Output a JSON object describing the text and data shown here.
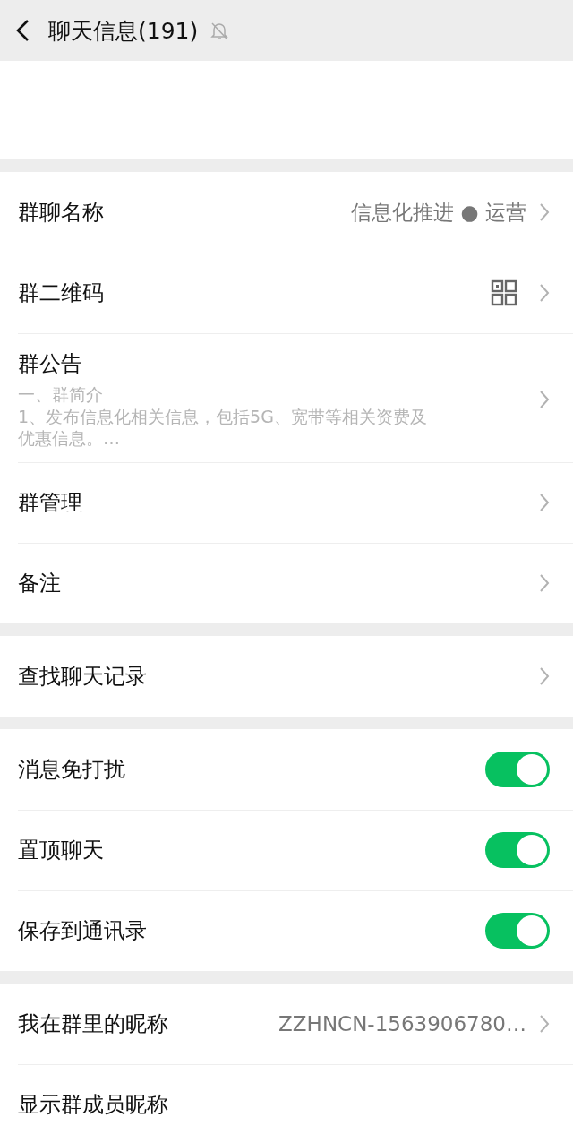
{
  "header": {
    "title": "聊天信息(191)",
    "muted": true
  },
  "sections": [
    {
      "rows": [
        {
          "kind": "nav",
          "label": "群聊名称",
          "value": "信息化推进 ● 运营"
        },
        {
          "kind": "qr",
          "label": "群二维码"
        },
        {
          "kind": "notice",
          "label": "群公告",
          "lines": [
            "一、群简介",
            "1、发布信息化相关信息，包括5G、宽带等相关资费及",
            "优惠信息。…"
          ]
        },
        {
          "kind": "nav",
          "label": "群管理"
        },
        {
          "kind": "nav",
          "label": "备注"
        }
      ]
    },
    {
      "rows": [
        {
          "kind": "nav",
          "label": "查找聊天记录"
        }
      ]
    },
    {
      "rows": [
        {
          "kind": "toggle",
          "label": "消息免打扰",
          "on": true
        },
        {
          "kind": "toggle",
          "label": "置顶聊天",
          "on": true
        },
        {
          "kind": "toggle",
          "label": "保存到通讯录",
          "on": true
        }
      ]
    },
    {
      "rows": [
        {
          "kind": "nav",
          "label": "我在群里的昵称",
          "value": "ZZHNCN-1563906780…"
        },
        {
          "kind": "plain",
          "label": "显示群成员昵称"
        }
      ]
    }
  ]
}
